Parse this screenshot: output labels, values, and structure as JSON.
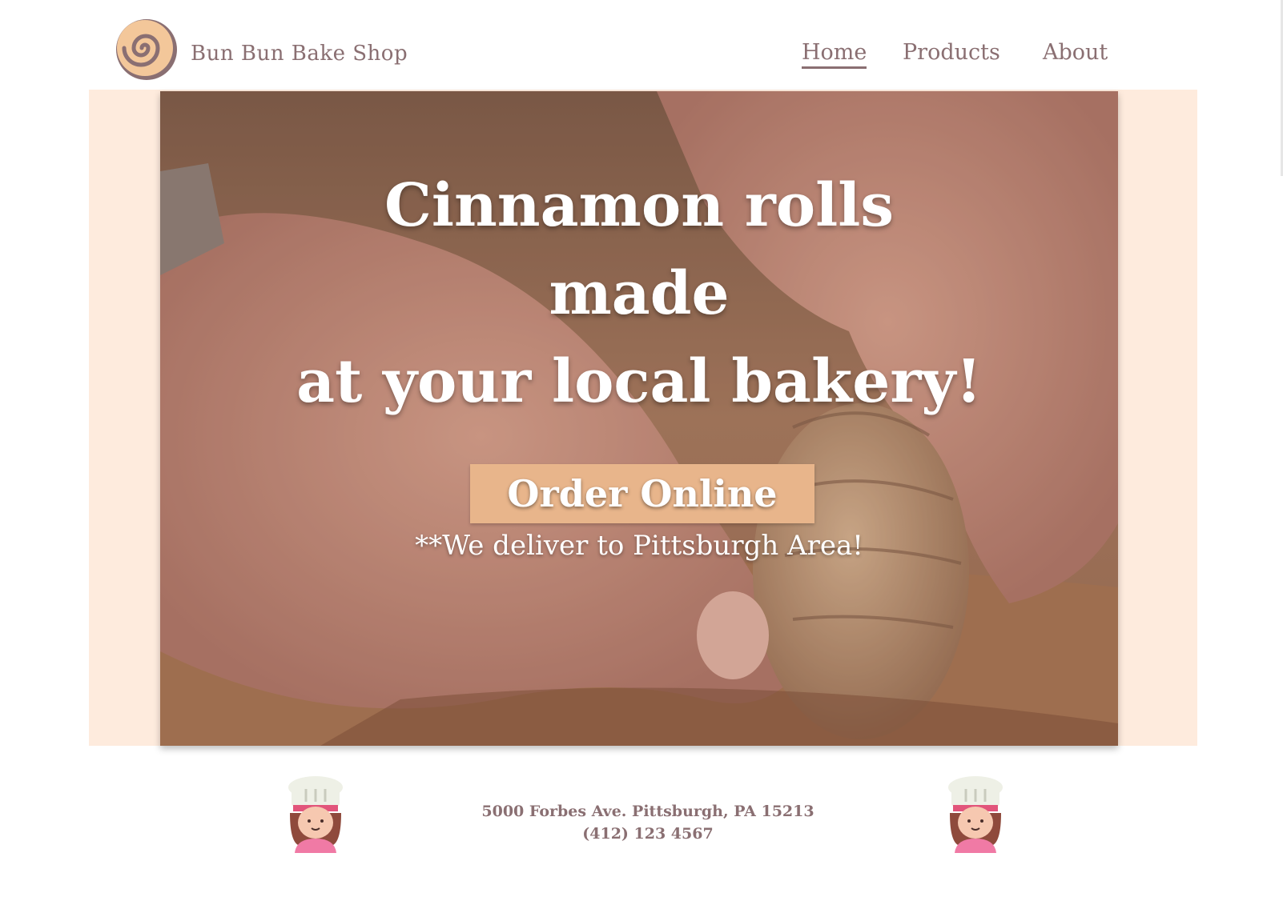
{
  "header": {
    "brand": "Bun Bun Bake Shop",
    "logo_icon": "cinnamon-roll-icon",
    "nav": [
      {
        "label": "Home",
        "active": true
      },
      {
        "label": "Products",
        "active": false
      },
      {
        "label": "About",
        "active": false
      }
    ]
  },
  "hero": {
    "headline_line1": "Cinnamon rolls",
    "headline_line2": "made",
    "headline_line3": "at your local bakery!",
    "cta_label": "Order Online",
    "delivery_note": "**We deliver to Pittsburgh Area!",
    "background_image": "hands-shaping-cinnamon-roll-photo"
  },
  "footer": {
    "address": "5000 Forbes Ave. Pittsburgh, PA 15213",
    "phone": "(412) 123 4567",
    "left_icon": "baker-girl-icon",
    "right_icon": "baker-girl-icon"
  },
  "colors": {
    "brand_text": "#8a6f72",
    "band": "#feebdd",
    "button": "#e8b58b",
    "logo_outer": "#8a6f72",
    "logo_inner": "#f3c79a"
  }
}
